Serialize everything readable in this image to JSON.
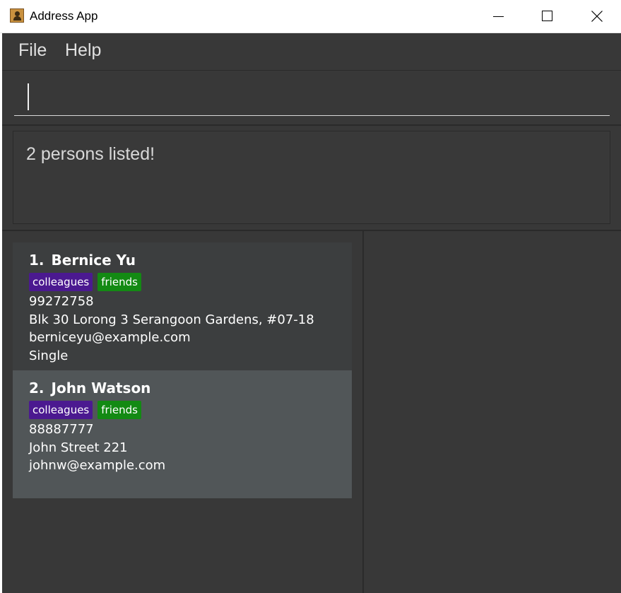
{
  "window": {
    "title": "Address App",
    "controls": {
      "minimize": "minimize",
      "maximize": "maximize",
      "close": "close"
    }
  },
  "menu": {
    "items": [
      "File",
      "Help"
    ]
  },
  "command": {
    "value": "",
    "placeholder": ""
  },
  "result": {
    "message": "2 persons listed!"
  },
  "persons": [
    {
      "index": "1.",
      "name": "Bernice Yu",
      "tags": [
        "colleagues",
        "friends"
      ],
      "phone": "99272758",
      "address": "Blk 30 Lorong 3 Serangoon Gardens, #07-18",
      "email": "berniceyu@example.com",
      "status": "Single",
      "selected": false
    },
    {
      "index": "2.",
      "name": "John Watson",
      "tags": [
        "colleagues",
        "friends"
      ],
      "phone": "88887777",
      "address": "John Street 221",
      "email": "johnw@example.com",
      "status": "",
      "selected": true
    }
  ],
  "colors": {
    "background": "#383838",
    "card": "#3c3e3f",
    "card_selected": "#515658",
    "tag_colleagues": "#4b1990",
    "tag_friends": "#138a13"
  }
}
